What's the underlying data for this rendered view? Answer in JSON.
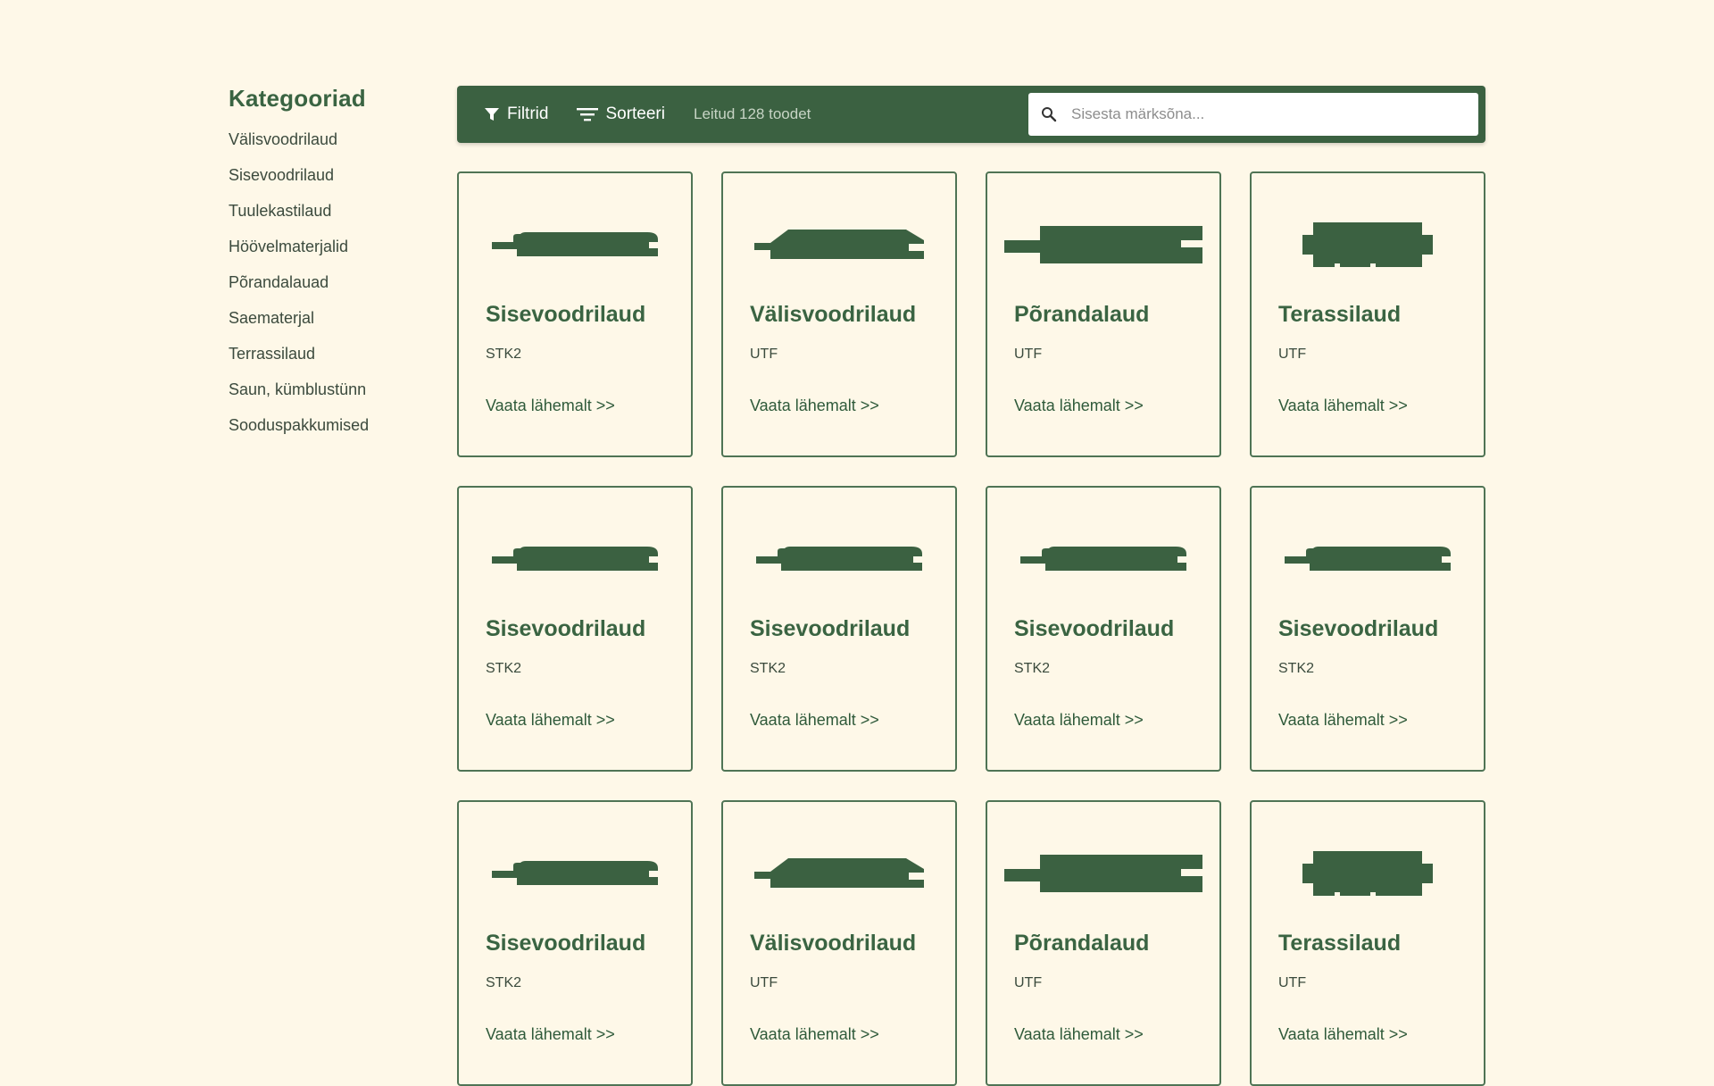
{
  "sidebar": {
    "title": "Kategooriad",
    "items": [
      {
        "label": "Välisvoodrilaud"
      },
      {
        "label": "Sisevoodrilaud"
      },
      {
        "label": "Tuulekastilaud"
      },
      {
        "label": "Höövelmaterjalid"
      },
      {
        "label": "Põrandalauad"
      },
      {
        "label": "Saematerjal"
      },
      {
        "label": "Terrassilaud"
      },
      {
        "label": "Saun, kümblustünn"
      },
      {
        "label": "Sooduspakkumised"
      }
    ]
  },
  "toolbar": {
    "filter_label": "Filtrid",
    "filter_icon": "filter-funnel-icon",
    "sort_label": "Sorteeri",
    "sort_icon": "sort-lines-icon",
    "result_count": "Leitud 128 toodet",
    "search_icon": "search-icon",
    "search_placeholder": "Sisesta märksõna...",
    "search_value": ""
  },
  "colors": {
    "background": "#fef8e8",
    "accent": "#3b6141",
    "card_border": "#4f7455"
  },
  "products": [
    {
      "title": "Sisevoodrilaud",
      "code": "STK2",
      "link": "Vaata lähemalt >>",
      "profile": "sise"
    },
    {
      "title": "Välisvoodrilaud",
      "code": "UTF",
      "link": "Vaata lähemalt >>",
      "profile": "valis"
    },
    {
      "title": "Põrandalaud",
      "code": "UTF",
      "link": "Vaata lähemalt >>",
      "profile": "porand"
    },
    {
      "title": "Terassilaud",
      "code": "UTF",
      "link": "Vaata lähemalt >>",
      "profile": "terass"
    },
    {
      "title": "Sisevoodrilaud",
      "code": "STK2",
      "link": "Vaata lähemalt >>",
      "profile": "sise"
    },
    {
      "title": "Sisevoodrilaud",
      "code": "STK2",
      "link": "Vaata lähemalt >>",
      "profile": "sise"
    },
    {
      "title": "Sisevoodrilaud",
      "code": "STK2",
      "link": "Vaata lähemalt >>",
      "profile": "sise"
    },
    {
      "title": "Sisevoodrilaud",
      "code": "STK2",
      "link": "Vaata lähemalt >>",
      "profile": "sise"
    },
    {
      "title": "Sisevoodrilaud",
      "code": "STK2",
      "link": "Vaata lähemalt >>",
      "profile": "sise"
    },
    {
      "title": "Välisvoodrilaud",
      "code": "UTF",
      "link": "Vaata lähemalt >>",
      "profile": "valis"
    },
    {
      "title": "Põrandalaud",
      "code": "UTF",
      "link": "Vaata lähemalt >>",
      "profile": "porand"
    },
    {
      "title": "Terassilaud",
      "code": "UTF",
      "link": "Vaata lähemalt >>",
      "profile": "terass"
    }
  ]
}
